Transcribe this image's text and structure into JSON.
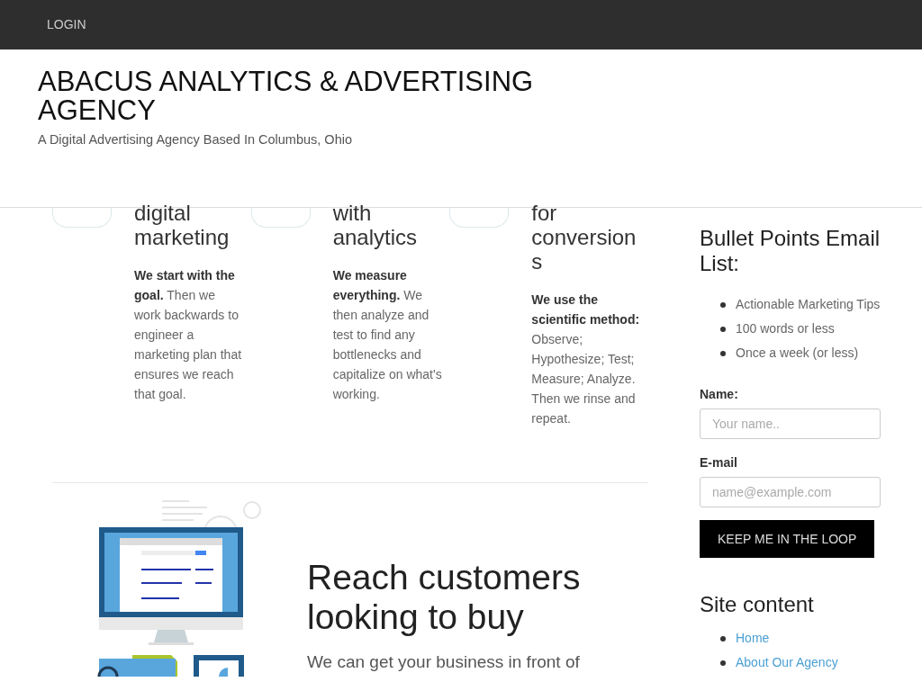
{
  "top_bar": {
    "login_link": "LOGIN"
  },
  "header": {
    "site_title": "ABACUS ANALYTICS & ADVERTISING AGENCY",
    "tagline": "A Digital Advertising Agency Based In Columbus, Ohio"
  },
  "features": [
    {
      "heading": "digital marketing",
      "text": "**We start with the goal.** Then we work backwards to engineer a marketing plan that ensures we reach that goal."
    },
    {
      "heading": "with analytics",
      "text": "**We measure everything.** We then analyze and test to find any bottlenecks and capitalize on what's working."
    },
    {
      "heading": "for conversions",
      "text": "**We use the scientific method:** Observe; Hypothesize; Test; Measure; Analyze. Then we rinse and repeat."
    }
  ],
  "section": {
    "heading": "Reach customers looking to buy",
    "text": "We can get your business in front of"
  },
  "sidebar": {
    "newsletter": {
      "heading": "Bullet Points Email List:",
      "points": [
        "Actionable Marketing Tips",
        "100 words or less",
        "Once a week (or less)"
      ],
      "fields": [
        {
          "label": "Name:",
          "placeholder": "Your name.."
        },
        {
          "label": "E-mail",
          "placeholder": "name@example.com"
        }
      ],
      "button": "KEEP ME IN THE LOOP"
    },
    "site_content": {
      "heading": "Site content",
      "links": [
        "Home",
        "About Our Agency"
      ]
    }
  }
}
